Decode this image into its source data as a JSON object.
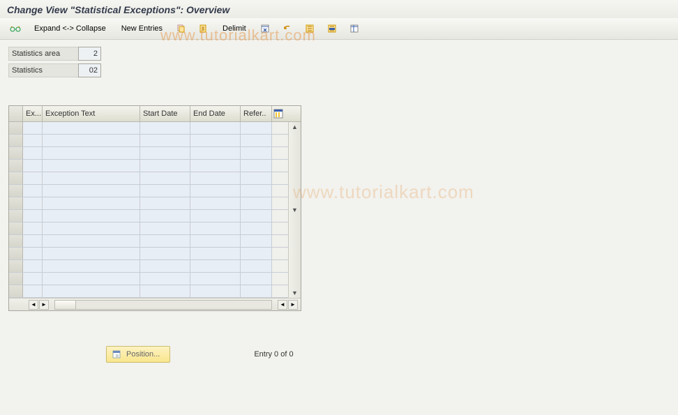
{
  "title": "Change View \"Statistical Exceptions\": Overview",
  "toolbar": {
    "expand_collapse": "Expand <-> Collapse",
    "new_entries": "New Entries",
    "delimit": "Delimit"
  },
  "fields": {
    "statistics_area_label": "Statistics area",
    "statistics_area_value": "2",
    "statistics_label": "Statistics",
    "statistics_value": "02"
  },
  "table": {
    "columns": {
      "ex": "Ex...",
      "exception_text": "Exception Text",
      "start_date": "Start Date",
      "end_date": "End Date",
      "refer": "Refer.."
    },
    "rows": []
  },
  "footer": {
    "position_label": "Position...",
    "entry_text": "Entry 0 of 0"
  },
  "watermark": "www.tutorialkart.com"
}
